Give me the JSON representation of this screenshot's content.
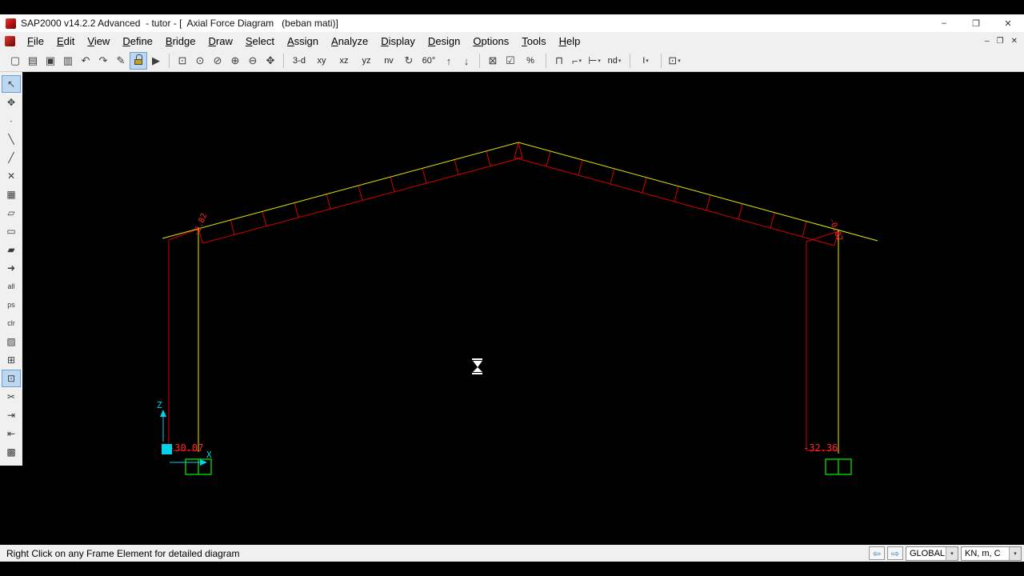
{
  "window": {
    "title": "SAP2000 v14.2.2 Advanced  - tutor - [  Axial Force Diagram   (beban mati)]",
    "controls": [
      {
        "name": "minimize-button",
        "glyph": "–"
      },
      {
        "name": "restore-button",
        "glyph": "❐"
      },
      {
        "name": "close-button",
        "glyph": "✕"
      }
    ]
  },
  "menubar": {
    "items": [
      "File",
      "Edit",
      "View",
      "Define",
      "Bridge",
      "Draw",
      "Select",
      "Assign",
      "Analyze",
      "Display",
      "Design",
      "Options",
      "Tools",
      "Help"
    ],
    "mdi_controls": [
      {
        "name": "mdi-minimize-button",
        "glyph": "–"
      },
      {
        "name": "mdi-restore-button",
        "glyph": "❐"
      },
      {
        "name": "mdi-close-button",
        "glyph": "✕"
      }
    ]
  },
  "toolbar": {
    "caret": "▾",
    "items": [
      {
        "name": "new-model-button",
        "glyph": "▢"
      },
      {
        "name": "open-file-button",
        "glyph": "▤"
      },
      {
        "name": "save-model-button",
        "glyph": "▣"
      },
      {
        "name": "print-button",
        "glyph": "▥"
      },
      {
        "name": "undo-button",
        "glyph": "↶"
      },
      {
        "name": "redo-button",
        "glyph": "↷"
      },
      {
        "name": "pencil-edit-button",
        "glyph": "✎"
      },
      {
        "name": "lock-model-button",
        "icon": "lock-css",
        "active": true
      },
      {
        "name": "run-analysis-button",
        "glyph": "▶"
      },
      {
        "sep": true
      },
      {
        "name": "rubber-band-zoom-button",
        "glyph": "⊡"
      },
      {
        "name": "restore-full-view-button",
        "glyph": "⊙"
      },
      {
        "name": "previous-zoom-button",
        "glyph": "⊘"
      },
      {
        "name": "zoom-in-button",
        "glyph": "⊕"
      },
      {
        "name": "zoom-out-button",
        "glyph": "⊖"
      },
      {
        "name": "pan-button",
        "glyph": "✥"
      },
      {
        "sep": true
      },
      {
        "name": "view-3d-button",
        "label": "3-d",
        "text": true
      },
      {
        "name": "view-xy-button",
        "label": "xy",
        "text": true
      },
      {
        "name": "view-xz-button",
        "label": "xz",
        "text": true
      },
      {
        "name": "view-yz-button",
        "label": "yz",
        "text": true
      },
      {
        "name": "view-nv-button",
        "label": "nv",
        "text": true
      },
      {
        "name": "rotate-view-button",
        "glyph": "↻"
      },
      {
        "name": "perspective-angle-button",
        "label": "60°",
        "text": true
      },
      {
        "name": "move-up-button",
        "glyph": "↑"
      },
      {
        "name": "move-down-button",
        "glyph": "↓"
      },
      {
        "sep": true
      },
      {
        "name": "object-shrink-button",
        "glyph": "⊠"
      },
      {
        "name": "set-display-options-button",
        "glyph": "☑"
      },
      {
        "name": "show-forces-button",
        "label": "%",
        "text": true
      },
      {
        "sep": true
      },
      {
        "name": "frame-releases-button",
        "glyph": "⊓"
      },
      {
        "name": "assign-frame-button",
        "glyph": "⌐",
        "caret": true
      },
      {
        "name": "assign-joint-button",
        "glyph": "⊢",
        "caret": true
      },
      {
        "name": "named-display-button",
        "label": "nd",
        "text": true,
        "caret": true
      },
      {
        "sep": true
      },
      {
        "name": "frame-sections-button",
        "label": "I",
        "text": true,
        "caret": true
      },
      {
        "sep": true
      },
      {
        "name": "window-options-button",
        "glyph": "⊡",
        "caret": true
      }
    ]
  },
  "side_toolbar": {
    "items": [
      {
        "name": "tool-pointer-button",
        "glyph": "↖",
        "active": true
      },
      {
        "name": "tool-reshape-button",
        "glyph": "✥"
      },
      {
        "name": "tool-draw-joint-button",
        "glyph": "∙"
      },
      {
        "name": "tool-draw-frame-button",
        "glyph": "╲"
      },
      {
        "name": "tool-quick-frame-button",
        "glyph": "╱"
      },
      {
        "name": "tool-delete-button",
        "glyph": "✕"
      },
      {
        "name": "tool-draw-area-button",
        "glyph": "▦"
      },
      {
        "name": "tool-quick-area-button",
        "glyph": "▱"
      },
      {
        "name": "tool-draw-rect-button",
        "glyph": "▭"
      },
      {
        "name": "tool-draw-poly-button",
        "glyph": "▰"
      },
      {
        "name": "tool-select-arrow-button",
        "glyph": "➜"
      },
      {
        "name": "tool-select-all-button",
        "label": "all",
        "text": true
      },
      {
        "name": "tool-previous-selection-button",
        "label": "ps",
        "text": true
      },
      {
        "name": "tool-clear-selection-button",
        "label": "clr",
        "text": true
      },
      {
        "name": "tool-invert-selection-button",
        "glyph": "▨"
      },
      {
        "name": "tool-set-display-button",
        "glyph": "⊞"
      },
      {
        "name": "tool-show-forces-button",
        "glyph": "⊡",
        "active": true
      },
      {
        "name": "tool-divide-frame-button",
        "glyph": "✂"
      },
      {
        "name": "tool-end-offset-button",
        "glyph": "⇥"
      },
      {
        "name": "tool-start-offset-button",
        "glyph": "⇤"
      },
      {
        "name": "tool-grid-button",
        "glyph": "▩"
      }
    ]
  },
  "canvas": {
    "axis_labels": {
      "z": "Z",
      "x": "X"
    },
    "force_values": {
      "left_eave": "-0.82",
      "right_eave": "-0.82",
      "left_base": "-30.07",
      "right_base": "-32.36"
    }
  },
  "statusbar": {
    "message": "Right Click on any Frame Element for detailed diagram",
    "nav": [
      {
        "name": "previous-window-button",
        "glyph": "⇦"
      },
      {
        "name": "next-window-button",
        "glyph": "⇨"
      }
    ],
    "coord_system": "GLOBAL",
    "units": "KN, m, C",
    "dropdown_caret": "▾"
  },
  "colors": {
    "member_yellow": "#e8e800",
    "axial_red": "#d40000",
    "value_red": "#ff2a2a",
    "support_green": "#00c800",
    "axis_cyan": "#00d2e8"
  }
}
